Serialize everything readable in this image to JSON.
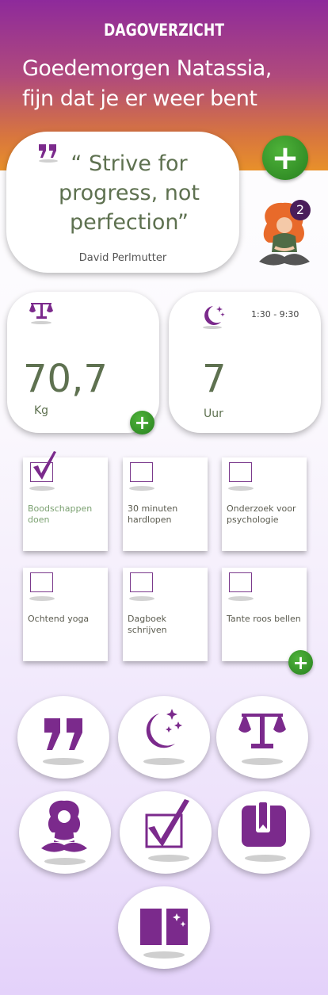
{
  "header": {
    "title": "DAGOVERZICHT",
    "greeting_line1": "Goedemorgen Natassia,",
    "greeting_line2": "fijn dat je er weer bent"
  },
  "quote": {
    "text": "“ Strive for progress, not perfection”",
    "author": "David Perlmutter"
  },
  "notifications": {
    "count": "2"
  },
  "weight": {
    "value": "70,7",
    "unit": "Kg"
  },
  "sleep": {
    "time_range": "1:30 - 9:30",
    "value": "7",
    "unit": "Uur"
  },
  "tasks": [
    {
      "label": "Boodschappen doen",
      "done": true
    },
    {
      "label": "30 minuten hardlopen",
      "done": false
    },
    {
      "label": "Onderzoek voor psychologie",
      "done": false
    },
    {
      "label": "Ochtend yoga",
      "done": false
    },
    {
      "label": "Dagboek schrijven",
      "done": false
    },
    {
      "label": "Tante roos bellen",
      "done": false
    }
  ],
  "nav_icons": [
    "quote-icon",
    "moon-icon",
    "scale-icon",
    "yoga-icon",
    "checkbox-icon",
    "journal-icon",
    "book-icon"
  ],
  "colors": {
    "accent_purple": "#7b2a8c",
    "text_green": "#5e7150",
    "plus_green": "#3a9a2c",
    "header_top": "#8e2a9b",
    "header_bottom": "#e8902a"
  }
}
